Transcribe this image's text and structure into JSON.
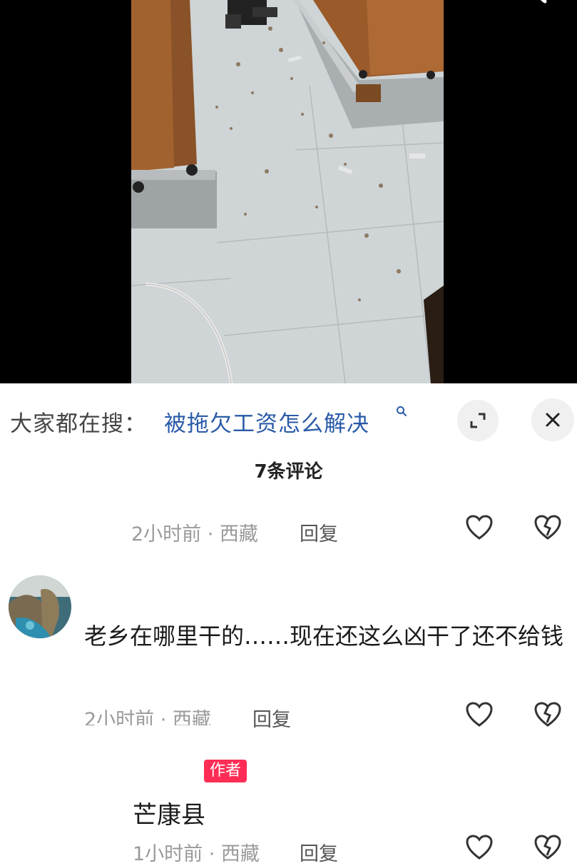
{
  "search_suggestion": {
    "prefix": "大家都在搜：",
    "query": "被拖欠工资怎么解决"
  },
  "comments_header": {
    "count_label": "7条评论"
  },
  "comments": [
    {
      "time_location": "2小时前 · 西藏",
      "reply_label": "回复"
    },
    {
      "text": "老乡在哪里干的……现在还这么凶干了还不给钱",
      "time_location": "2小时前 · 西藏",
      "reply_label": "回复"
    },
    {
      "badge": "作者",
      "username": "芒康县",
      "time_location": "1小时前 · 西藏",
      "reply_label": "回复"
    }
  ],
  "icons": {
    "top_right": "search-icon",
    "expand": "expand-icon",
    "close": "close-icon",
    "like": "heart-icon",
    "dislike": "broken-heart-icon"
  }
}
